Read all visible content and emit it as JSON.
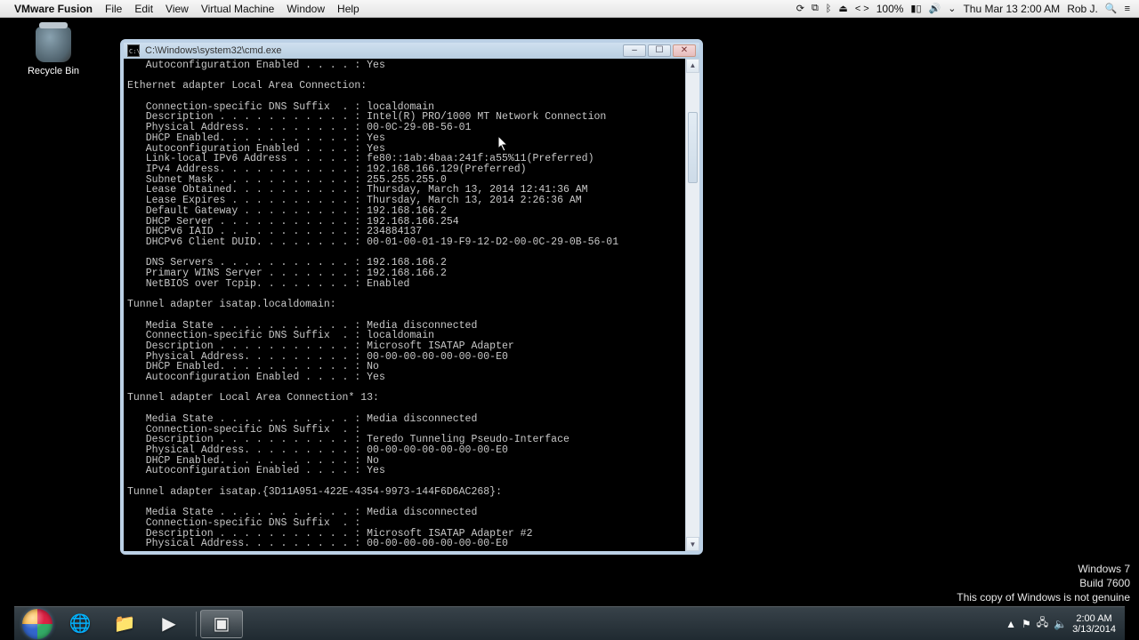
{
  "mac_menubar": {
    "app_name": "VMware Fusion",
    "menus": [
      "File",
      "Edit",
      "View",
      "Virtual Machine",
      "Window",
      "Help"
    ],
    "battery_pct": "100%",
    "datetime": "Thu Mar 13  2:00 AM",
    "user": "Rob J."
  },
  "desktop": {
    "recycle_bin_label": "Recycle Bin"
  },
  "cmd_window": {
    "title": "C:\\Windows\\system32\\cmd.exe",
    "output": "   Autoconfiguration Enabled . . . . : Yes\n\nEthernet adapter Local Area Connection:\n\n   Connection-specific DNS Suffix  . : localdomain\n   Description . . . . . . . . . . . : Intel(R) PRO/1000 MT Network Connection\n   Physical Address. . . . . . . . . : 00-0C-29-0B-56-01\n   DHCP Enabled. . . . . . . . . . . : Yes\n   Autoconfiguration Enabled . . . . : Yes\n   Link-local IPv6 Address . . . . . : fe80::1ab:4baa:241f:a55%11(Preferred)\n   IPv4 Address. . . . . . . . . . . : 192.168.166.129(Preferred)\n   Subnet Mask . . . . . . . . . . . : 255.255.255.0\n   Lease Obtained. . . . . . . . . . : Thursday, March 13, 2014 12:41:36 AM\n   Lease Expires . . . . . . . . . . : Thursday, March 13, 2014 2:26:36 AM\n   Default Gateway . . . . . . . . . : 192.168.166.2\n   DHCP Server . . . . . . . . . . . : 192.168.166.254\n   DHCPv6 IAID . . . . . . . . . . . : 234884137\n   DHCPv6 Client DUID. . . . . . . . : 00-01-00-01-19-F9-12-D2-00-0C-29-0B-56-01\n\n   DNS Servers . . . . . . . . . . . : 192.168.166.2\n   Primary WINS Server . . . . . . . : 192.168.166.2\n   NetBIOS over Tcpip. . . . . . . . : Enabled\n\nTunnel adapter isatap.localdomain:\n\n   Media State . . . . . . . . . . . : Media disconnected\n   Connection-specific DNS Suffix  . : localdomain\n   Description . . . . . . . . . . . : Microsoft ISATAP Adapter\n   Physical Address. . . . . . . . . : 00-00-00-00-00-00-00-E0\n   DHCP Enabled. . . . . . . . . . . : No\n   Autoconfiguration Enabled . . . . : Yes\n\nTunnel adapter Local Area Connection* 13:\n\n   Media State . . . . . . . . . . . : Media disconnected\n   Connection-specific DNS Suffix  . :\n   Description . . . . . . . . . . . : Teredo Tunneling Pseudo-Interface\n   Physical Address. . . . . . . . . : 00-00-00-00-00-00-00-E0\n   DHCP Enabled. . . . . . . . . . . : No\n   Autoconfiguration Enabled . . . . : Yes\n\nTunnel adapter isatap.{3D11A951-422E-4354-9973-144F6D6AC268}:\n\n   Media State . . . . . . . . . . . : Media disconnected\n   Connection-specific DNS Suffix  . :\n   Description . . . . . . . . . . . : Microsoft ISATAP Adapter #2\n   Physical Address. . . . . . . . . : 00-00-00-00-00-00-00-E0"
  },
  "watermark": {
    "line1": "Windows 7",
    "line2": "Build 7600",
    "line3": "This copy of Windows is not genuine"
  },
  "taskbar": {
    "clock_time": "2:00 AM",
    "clock_date": "3/13/2014"
  },
  "icons": {
    "apple": "",
    "sync": "⟳",
    "screen": "⧉",
    "bt": "ᛒ",
    "eject": "⏏",
    "code": "< >",
    "battery": "▮▯",
    "speaker": "🔊",
    "wifi": "⌄",
    "search": "🔍",
    "menu": "≡",
    "ie": "🌐",
    "folder": "📁",
    "wmp": "▶",
    "cmd": "▣",
    "flag": "⚑",
    "net": "🖧",
    "vol": "🔈",
    "up": "▲",
    "down": "▼",
    "min": "–",
    "max": "☐",
    "close": "✕"
  }
}
